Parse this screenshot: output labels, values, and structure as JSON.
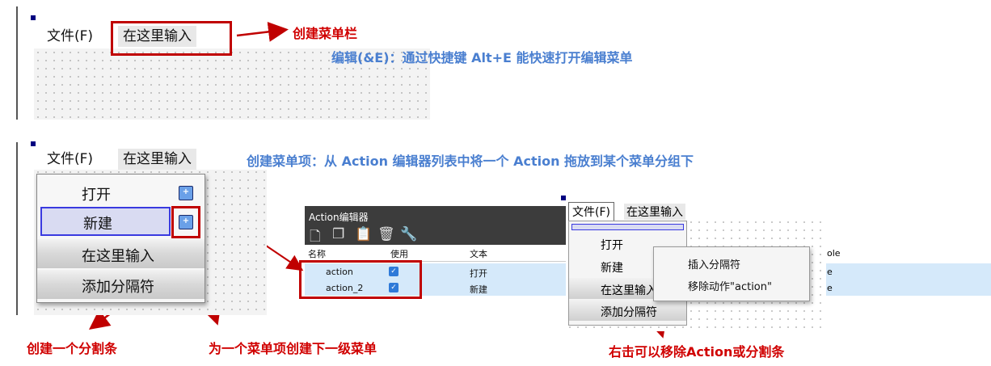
{
  "scene1": {
    "menubar": {
      "file": "文件(F)",
      "placeholder": "在这里输入"
    },
    "annotation_create_menubar": "创建菜单栏",
    "annotation_shortcut": "编辑(&E)：通过快捷键 Alt+E 能快速打开编辑菜单"
  },
  "scene2": {
    "menubar": {
      "file": "文件(F)",
      "placeholder": "在这里输入"
    },
    "annotation_create_item": "创建菜单项：从 Action 编辑器列表中将一个 Action 拖放到某个菜单分组下",
    "menu_items": [
      "打开",
      "新建",
      "在这里输入",
      "添加分隔符"
    ],
    "annotation_separator": "创建一个分割条",
    "annotation_submenu": "为一个菜单项创建下一级菜单"
  },
  "action_editor": {
    "title": "Action编辑器",
    "columns": [
      "名称",
      "使用",
      "文本"
    ],
    "rows": [
      {
        "name": "action",
        "text": "打开"
      },
      {
        "name": "action_2",
        "text": "新建"
      }
    ]
  },
  "scene3": {
    "menubar": {
      "file": "文件(F)",
      "placeholder": "在这里输入"
    },
    "menu_items": [
      "打开",
      "新建",
      "在这里输入",
      "添加分隔符"
    ],
    "context_menu": [
      "插入分隔符",
      "移除动作\"action\""
    ],
    "right_col_header": "ole",
    "right_col_cells": [
      "e",
      "e"
    ],
    "annotation_remove": "右击可以移除Action或分割条"
  },
  "colors": {
    "red": "#d00000",
    "blue": "#4a7fd0",
    "accent": "#3a3ae0"
  }
}
